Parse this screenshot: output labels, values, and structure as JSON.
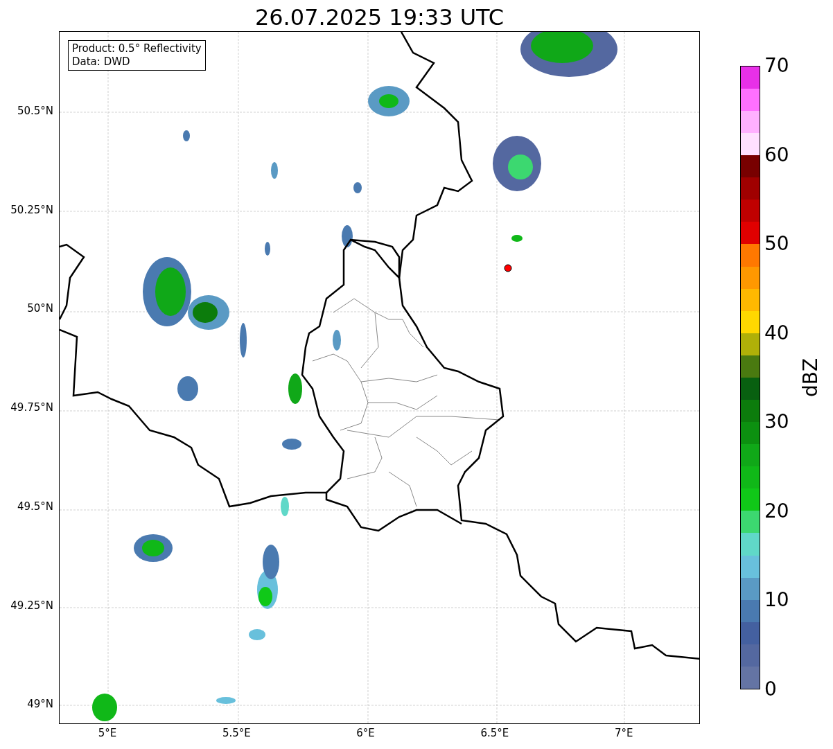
{
  "title": "26.07.2025 19:33 UTC",
  "legend": [
    "Product: 0.5° Reflectivity",
    "Data: DWD"
  ],
  "lat_ticks": [
    "50.5°N",
    "50.25°N",
    "50°N",
    "49.75°N",
    "49.5°N",
    "49.25°N",
    "49°N"
  ],
  "lon_ticks": [
    "5°E",
    "5.5°E",
    "6°E",
    "6.5°E",
    "7°E"
  ],
  "colorbar": {
    "label": "dBZ",
    "ticks": [
      "70",
      "60",
      "50",
      "40",
      "30",
      "20",
      "10",
      "0"
    ],
    "bins": [
      {
        "color": "#6474a4"
      },
      {
        "color": "#5468a0"
      },
      {
        "color": "#4460a0"
      },
      {
        "color": "#4a7ab0"
      },
      {
        "color": "#5a9ac4"
      },
      {
        "color": "#68c0dc"
      },
      {
        "color": "#60d8c8"
      },
      {
        "color": "#3cd870"
      },
      {
        "color": "#10c818"
      },
      {
        "color": "#10b818"
      },
      {
        "color": "#10a818"
      },
      {
        "color": "#0c9010"
      },
      {
        "color": "#0c7c0c"
      },
      {
        "color": "#086010"
      },
      {
        "color": "#4a7a10"
      },
      {
        "color": "#b0b008"
      },
      {
        "color": "#ffd800"
      },
      {
        "color": "#ffb800"
      },
      {
        "color": "#ff9800"
      },
      {
        "color": "#ff7800"
      },
      {
        "color": "#e00000"
      },
      {
        "color": "#c00000"
      },
      {
        "color": "#a00000"
      },
      {
        "color": "#780000"
      },
      {
        "color": "#ffe0ff"
      },
      {
        "color": "#ffb0ff"
      },
      {
        "color": "#ff70ff"
      },
      {
        "color": "#e830e8"
      }
    ]
  }
}
